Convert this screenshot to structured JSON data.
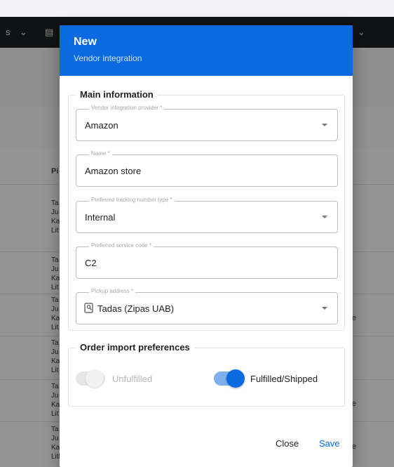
{
  "background": {
    "topbar_fragments": [
      "s",
      "⌄",
      "▤",
      "⌄"
    ],
    "table_header": "Pi",
    "rows": [
      {
        "lines": [
          "Ta",
          "Ju",
          "Ka",
          "Lit"
        ]
      },
      {
        "lines": [
          "Ta",
          "Ju",
          "Ka",
          "Lit"
        ]
      },
      {
        "lines": [
          "Ta",
          "Ju",
          "Ka",
          "Lit"
        ]
      },
      {
        "lines": [
          "Ta",
          "Ju",
          "Ka",
          "Lit"
        ]
      },
      {
        "lines": [
          "Ta",
          "Ju",
          "Ka",
          "Lit"
        ]
      },
      {
        "lines": [
          "Ta",
          "Ju",
          "Ka",
          "Lithuania"
        ]
      }
    ],
    "right_marker": "e"
  },
  "dialog": {
    "title": "New",
    "subtitle": "Vendor integration",
    "main_section": {
      "legend": "Main information",
      "fields": [
        {
          "label": "Vendor integration provider *",
          "value": "Amazon",
          "type": "select"
        },
        {
          "label": "Name *",
          "value": "Amazon store",
          "type": "text"
        },
        {
          "label": "Preferred tracking number type *",
          "value": "Internal",
          "type": "select"
        },
        {
          "label": "Preferred service code *",
          "value": "C2",
          "type": "text"
        },
        {
          "label": "Pickup address *",
          "value": "Tadas (Zipas UAB)",
          "type": "select",
          "icon": "location-pin-icon"
        }
      ]
    },
    "import_section": {
      "legend": "Order import preferences",
      "toggles": [
        {
          "label": "Unfulfilled",
          "on": false,
          "disabled": true
        },
        {
          "label": "Fulfilled/Shipped",
          "on": true,
          "disabled": false
        }
      ]
    },
    "buttons": {
      "close": "Close",
      "save": "Save"
    },
    "colors": {
      "header": "#0b6adf",
      "accent": "#0b6adf",
      "toggle_track_on": "#7fb0ee"
    }
  }
}
